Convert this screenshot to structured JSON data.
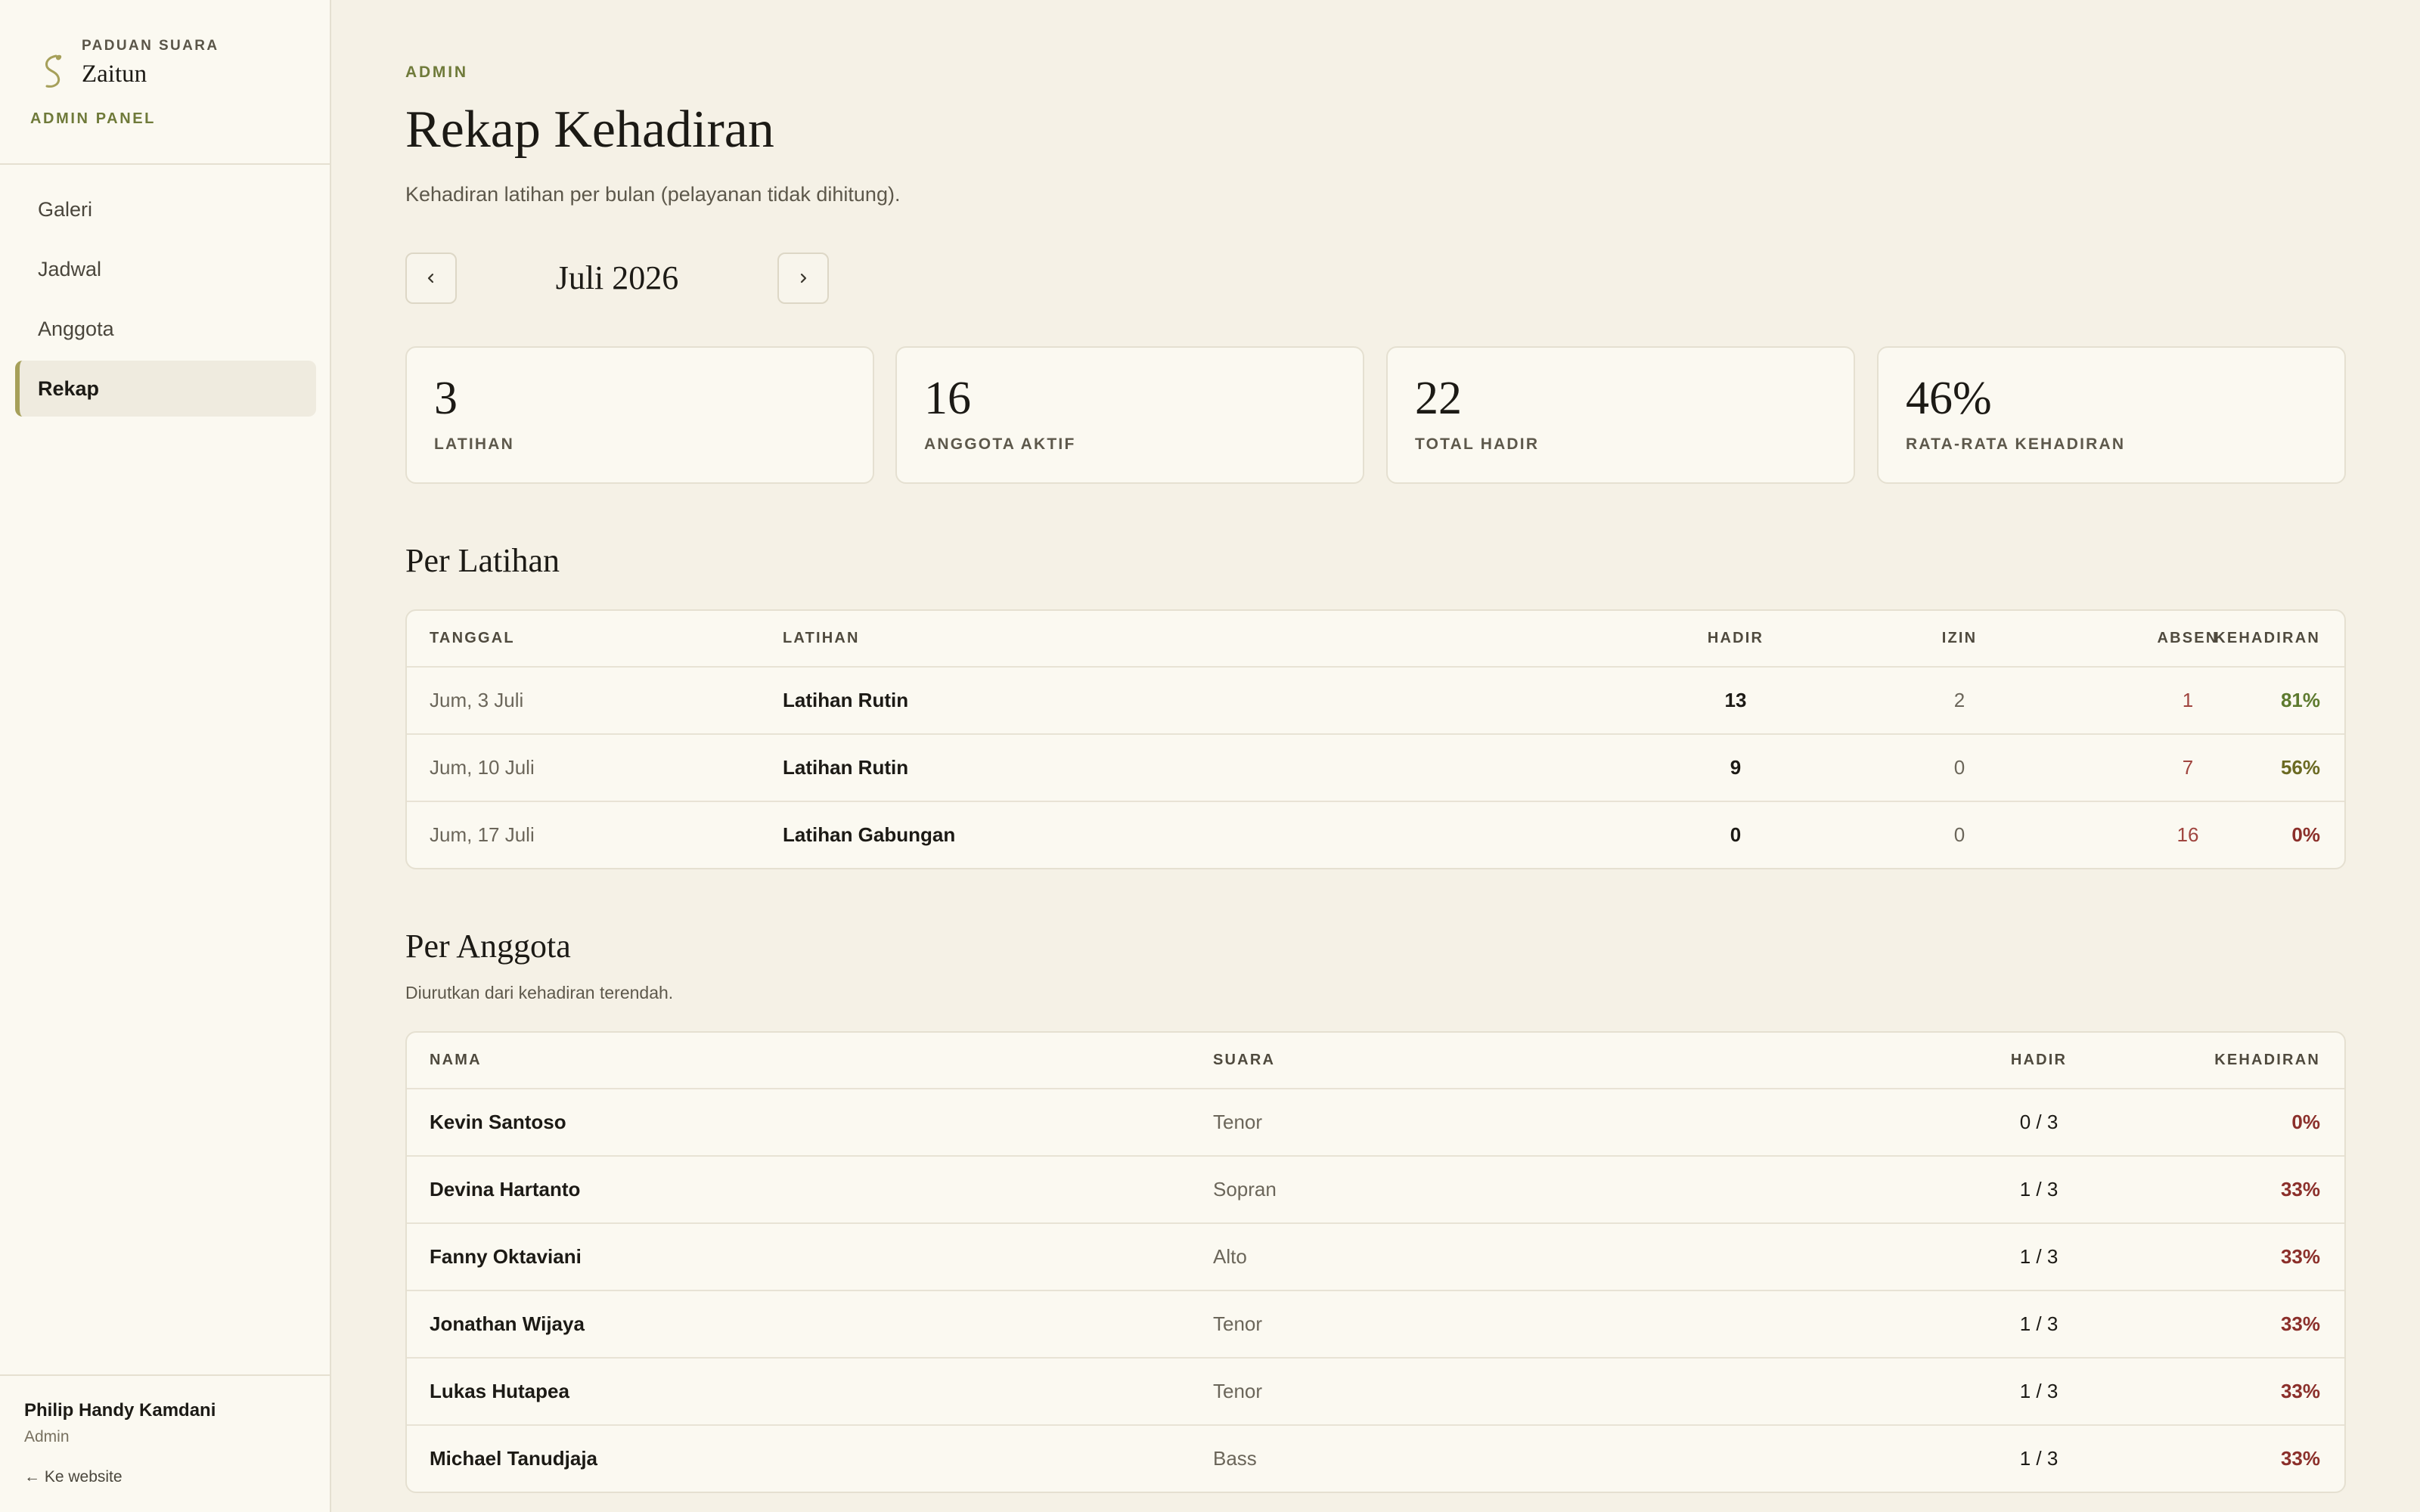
{
  "sidebar": {
    "brand_small": "PADUAN SUARA",
    "brand_name": "Zaitun",
    "panel_label": "ADMIN PANEL",
    "nav": [
      {
        "label": "Galeri",
        "active": false
      },
      {
        "label": "Jadwal",
        "active": false
      },
      {
        "label": "Anggota",
        "active": false
      },
      {
        "label": "Rekap",
        "active": true
      }
    ],
    "user": {
      "name": "Philip Handy Kamdani",
      "role": "Admin"
    },
    "back_link": "← Ke website"
  },
  "header": {
    "eyebrow": "ADMIN",
    "title": "Rekap Kehadiran",
    "subtitle": "Kehadiran latihan per bulan (pelayanan tidak dihitung)."
  },
  "month_nav": {
    "label": "Juli 2026",
    "prev_icon": "chevron-left-icon",
    "next_icon": "chevron-right-icon"
  },
  "stats": [
    {
      "value": "3",
      "label": "LATIHAN"
    },
    {
      "value": "16",
      "label": "ANGGOTA AKTIF"
    },
    {
      "value": "22",
      "label": "TOTAL HADIR"
    },
    {
      "value": "46%",
      "label": "RATA-RATA KEHADIRAN"
    }
  ],
  "per_latihan": {
    "title": "Per Latihan",
    "headers": {
      "tanggal": "TANGGAL",
      "latihan": "LATIHAN",
      "hadir": "HADIR",
      "izin": "IZIN",
      "absen": "ABSEN",
      "kehadiran": "KEHADIRAN"
    },
    "rows": [
      {
        "tanggal": "Jum, 3 Juli",
        "latihan": "Latihan Rutin",
        "hadir": "13",
        "izin": "2",
        "absen": "1",
        "kehadiran": "81%",
        "color": "#5d7a2e"
      },
      {
        "tanggal": "Jum, 10 Juli",
        "latihan": "Latihan Rutin",
        "hadir": "9",
        "izin": "0",
        "absen": "7",
        "kehadiran": "56%",
        "color": "#6b6a22"
      },
      {
        "tanggal": "Jum, 17 Juli",
        "latihan": "Latihan Gabungan",
        "hadir": "0",
        "izin": "0",
        "absen": "16",
        "kehadiran": "0%",
        "color": "#8b2f2a"
      }
    ]
  },
  "per_anggota": {
    "title": "Per Anggota",
    "note": "Diurutkan dari kehadiran terendah.",
    "headers": {
      "nama": "NAMA",
      "suara": "SUARA",
      "hadir": "HADIR",
      "kehadiran": "KEHADIRAN"
    },
    "rows": [
      {
        "nama": "Kevin Santoso",
        "suara": "Tenor",
        "hadir": "0 / 3",
        "kehadiran": "0%",
        "color": "#8b2f2a"
      },
      {
        "nama": "Devina Hartanto",
        "suara": "Sopran",
        "hadir": "1 / 3",
        "kehadiran": "33%",
        "color": "#8b2f2a"
      },
      {
        "nama": "Fanny Oktaviani",
        "suara": "Alto",
        "hadir": "1 / 3",
        "kehadiran": "33%",
        "color": "#8b2f2a"
      },
      {
        "nama": "Jonathan Wijaya",
        "suara": "Tenor",
        "hadir": "1 / 3",
        "kehadiran": "33%",
        "color": "#8b2f2a"
      },
      {
        "nama": "Lukas Hutapea",
        "suara": "Tenor",
        "hadir": "1 / 3",
        "kehadiran": "33%",
        "color": "#8b2f2a"
      },
      {
        "nama": "Michael Tanudjaja",
        "suara": "Bass",
        "hadir": "1 / 3",
        "kehadiran": "33%",
        "color": "#8b2f2a"
      }
    ]
  },
  "colors": {
    "accent": "#6f7a3a",
    "absen": "#a0453f",
    "background": "#f5f1e6"
  }
}
